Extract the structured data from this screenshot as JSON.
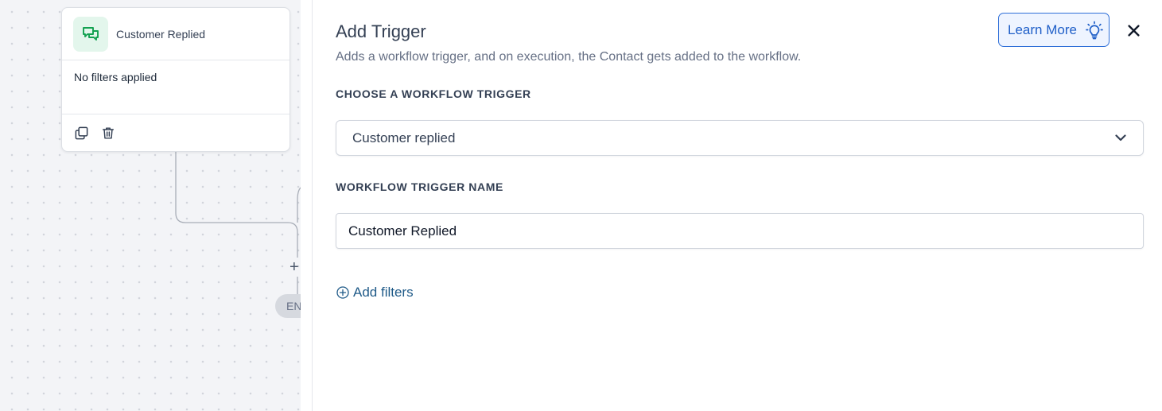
{
  "canvas": {
    "node": {
      "icon": "chat-bubbles-icon",
      "title": "Customer Replied",
      "filters_text": "No filters applied",
      "actions": [
        "copy-icon",
        "trash-icon"
      ]
    },
    "add_step_symbol": "+",
    "end_label": "END"
  },
  "panel": {
    "title": "Add Trigger",
    "subtitle": "Adds a workflow trigger, and on execution, the Contact gets added to the workflow.",
    "learn_more_label": "Learn More",
    "learn_more_icon": "lightbulb-icon",
    "close_icon": "close-icon",
    "trigger_section_label": "CHOOSE A WORKFLOW TRIGGER",
    "trigger_selected": "Customer replied",
    "name_section_label": "WORKFLOW TRIGGER NAME",
    "trigger_name_value": "Customer Replied",
    "add_filters_label": "Add filters"
  },
  "colors": {
    "accent_blue": "#1f5fc8",
    "trigger_icon_green": "#12a150",
    "trigger_icon_bg": "#e3f6ec",
    "link_blue": "#1f5a88"
  }
}
